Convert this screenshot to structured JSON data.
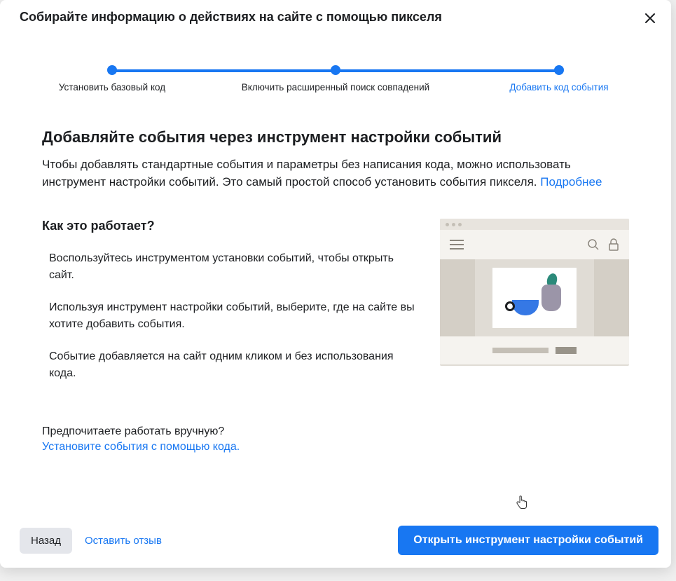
{
  "modal": {
    "title": "Собирайте информацию о действиях на сайте с помощью пикселя"
  },
  "stepper": {
    "step1": "Установить базовый код",
    "step2": "Включить расширенный поиск совпадений",
    "step3": "Добавить код события"
  },
  "content": {
    "heading": "Добавляйте события через инструмент настройки событий",
    "description": "Чтобы добавлять стандартные события и параметры без написания кода, можно использовать инструмент настройки событий. Это самый простой способ установить события пикселя. ",
    "learnMore": "Подробнее"
  },
  "how": {
    "title": "Как это работает?",
    "step1": "Воспользуйтесь инструментом установки событий, чтобы открыть сайт.",
    "step2": "Используя инструмент настройки событий, выберите, где на сайте вы хотите добавить события.",
    "step3": "Событие добавляется на сайт одним кликом и без использования кода."
  },
  "manual": {
    "question": "Предпочитаете работать вручную?",
    "link": "Установите события с помощью кода."
  },
  "footer": {
    "back": "Назад",
    "feedback": "Оставить отзыв",
    "primary": "Открыть инструмент настройки событий"
  }
}
